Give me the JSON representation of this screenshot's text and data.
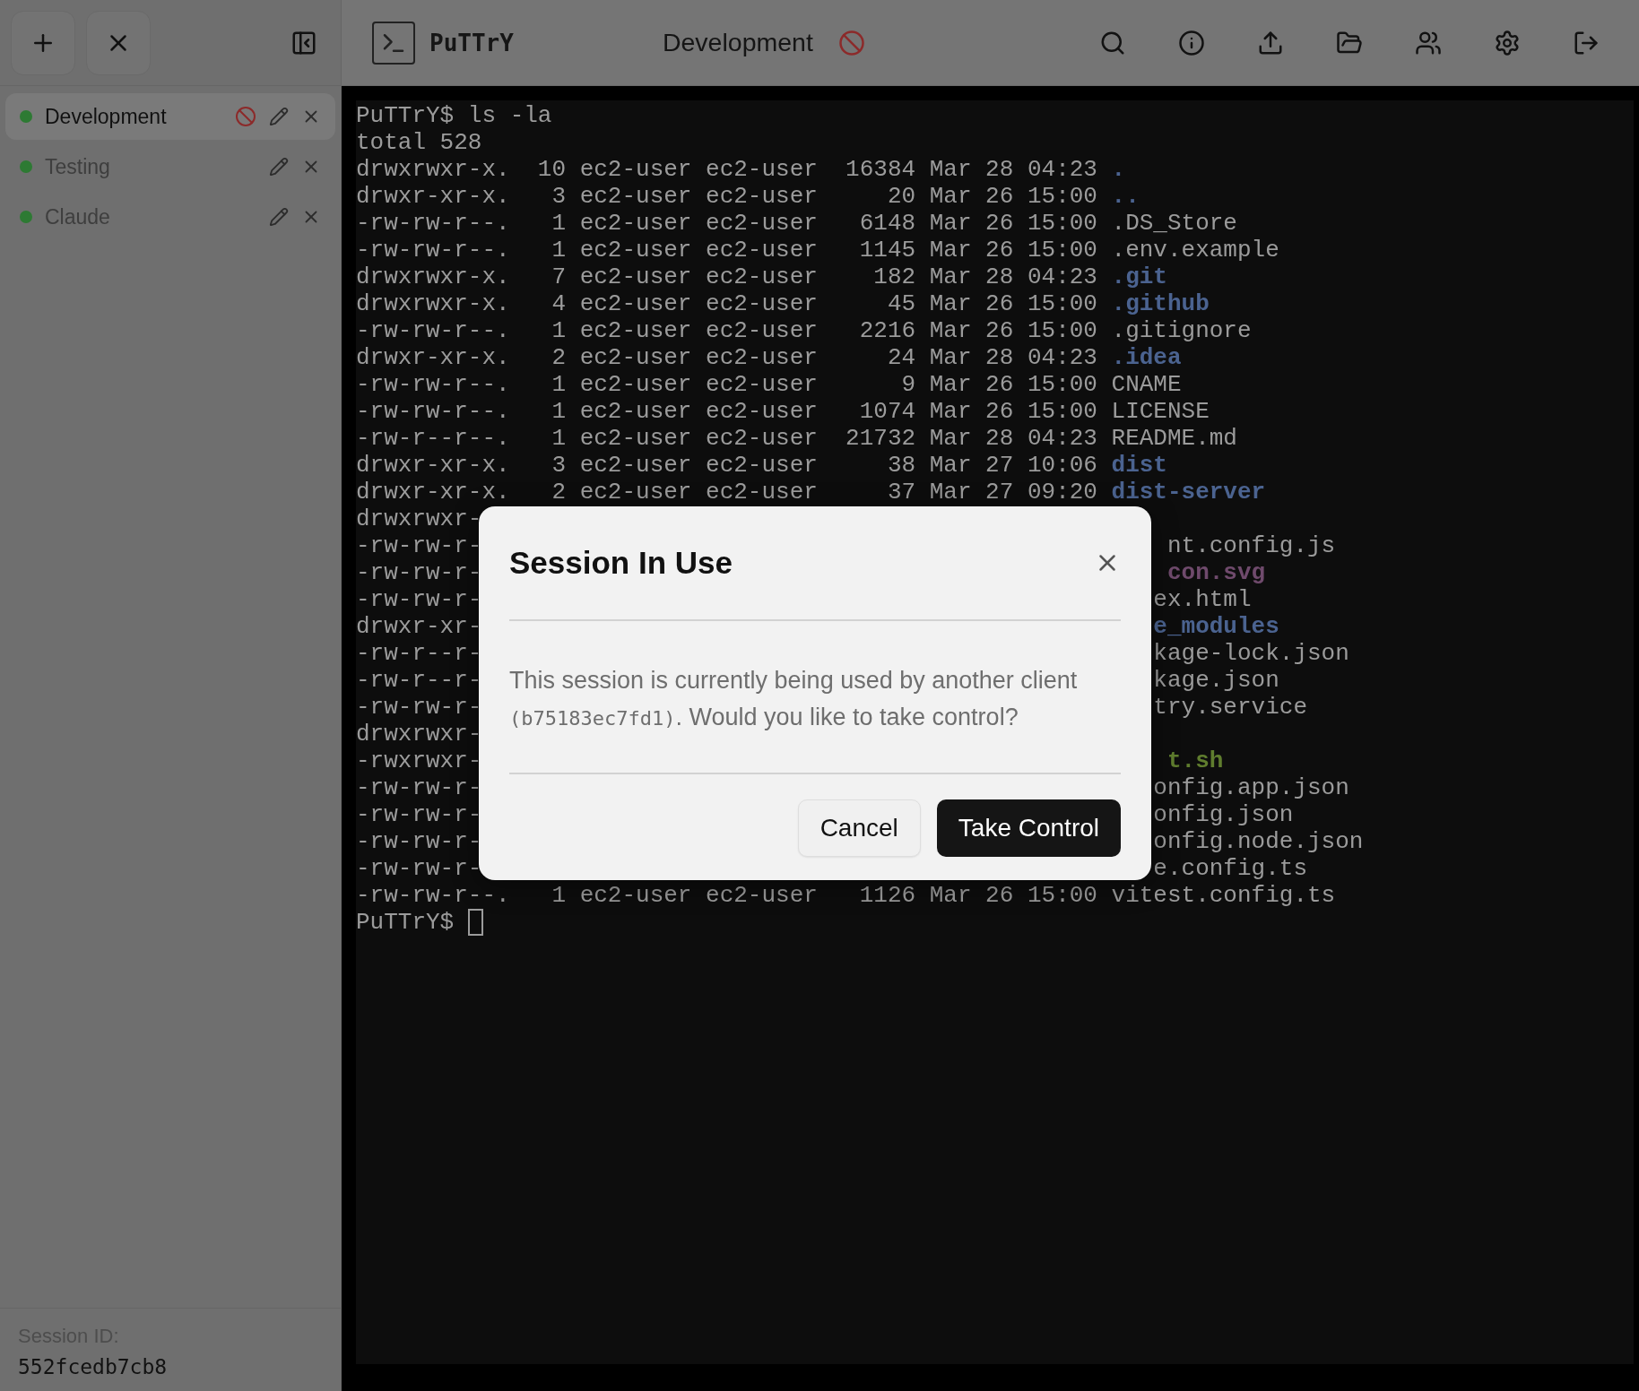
{
  "sidebar": {
    "sessions": [
      {
        "name": "Development",
        "selected": true,
        "in_use": true
      },
      {
        "name": "Testing",
        "selected": false,
        "in_use": false
      },
      {
        "name": "Claude",
        "selected": false,
        "in_use": false
      }
    ],
    "footer": {
      "label": "Session ID:",
      "value": "552fcedb7cb8"
    }
  },
  "header": {
    "app_name": "PuTTrY",
    "session_title": "Development",
    "in_use": true
  },
  "terminal": {
    "lines": [
      {
        "kind": "text",
        "text": "PuTTrY$ ls -la"
      },
      {
        "kind": "text",
        "text": "total 528"
      },
      {
        "kind": "entry",
        "info": "drwxrwxr-x.  10 ec2-user ec2-user  16384 Mar 28 04:23",
        "name": ".",
        "color": "#4b6390",
        "bold": true
      },
      {
        "kind": "entry",
        "info": "drwxr-xr-x.   3 ec2-user ec2-user     20 Mar 26 15:00",
        "name": "..",
        "color": "#4b6390",
        "bold": true
      },
      {
        "kind": "entry",
        "info": "-rw-rw-r--.   1 ec2-user ec2-user   6148 Mar 26 15:00",
        "name": ".DS_Store",
        "color": "#9b9b9b",
        "bold": false
      },
      {
        "kind": "entry",
        "info": "-rw-rw-r--.   1 ec2-user ec2-user   1145 Mar 26 15:00",
        "name": ".env.example",
        "color": "#9b9b9b",
        "bold": false
      },
      {
        "kind": "entry",
        "info": "drwxrwxr-x.   7 ec2-user ec2-user    182 Mar 28 04:23",
        "name": ".git",
        "color": "#4b6390",
        "bold": true
      },
      {
        "kind": "entry",
        "info": "drwxrwxr-x.   4 ec2-user ec2-user     45 Mar 26 15:00",
        "name": ".github",
        "color": "#4b6390",
        "bold": true
      },
      {
        "kind": "entry",
        "info": "-rw-rw-r--.   1 ec2-user ec2-user   2216 Mar 26 15:00",
        "name": ".gitignore",
        "color": "#9b9b9b",
        "bold": false
      },
      {
        "kind": "entry",
        "info": "drwxr-xr-x.   2 ec2-user ec2-user     24 Mar 28 04:23",
        "name": ".idea",
        "color": "#4b6390",
        "bold": true
      },
      {
        "kind": "entry",
        "info": "-rw-rw-r--.   1 ec2-user ec2-user      9 Mar 26 15:00",
        "name": "CNAME",
        "color": "#9b9b9b",
        "bold": false
      },
      {
        "kind": "entry",
        "info": "-rw-rw-r--.   1 ec2-user ec2-user   1074 Mar 26 15:00",
        "name": "LICENSE",
        "color": "#9b9b9b",
        "bold": false
      },
      {
        "kind": "entry",
        "info": "-rw-r--r--.   1 ec2-user ec2-user  21732 Mar 28 04:23",
        "name": "README.md",
        "color": "#9b9b9b",
        "bold": false
      },
      {
        "kind": "entry",
        "info": "drwxr-xr-x.   3 ec2-user ec2-user     38 Mar 27 10:06",
        "name": "dist",
        "color": "#4b6390",
        "bold": true
      },
      {
        "kind": "entry",
        "info": "drwxr-xr-x.   2 ec2-user ec2-user     37 Mar 27 09:20",
        "name": "dist-server",
        "color": "#4b6390",
        "bold": true
      },
      {
        "kind": "covered",
        "start": "drwxrwxr-"
      },
      {
        "kind": "covered",
        "start": "-rw-rw-r-",
        "end": "nt.config.js",
        "color": "#9b9b9b",
        "bold": false
      },
      {
        "kind": "covered",
        "start": "-rw-rw-r-",
        "end": "con.svg",
        "color": "#6f4a6c",
        "bold": true
      },
      {
        "kind": "covered",
        "start": "-rw-rw-r-",
        "end": "ex.html",
        "color": "#9b9b9b",
        "bold": false
      },
      {
        "kind": "covered",
        "start": "drwxr-xr-",
        "end": "e_modules",
        "color": "#4b6390",
        "bold": true
      },
      {
        "kind": "covered",
        "start": "-rw-r--r-",
        "end": "kage-lock.json",
        "color": "#9b9b9b",
        "bold": false
      },
      {
        "kind": "covered",
        "start": "-rw-r--r-",
        "end": "kage.json",
        "color": "#9b9b9b",
        "bold": false
      },
      {
        "kind": "covered",
        "start": "-rw-rw-r-",
        "end": "try.service",
        "color": "#9b9b9b",
        "bold": false
      },
      {
        "kind": "covered",
        "start": "drwxrwxr-"
      },
      {
        "kind": "covered",
        "start": "-rwxrwxr-",
        "end": "t.sh",
        "color": "#5f7d2e",
        "bold": true
      },
      {
        "kind": "covered",
        "start": "-rw-rw-r-",
        "end": "onfig.app.json",
        "color": "#9b9b9b",
        "bold": false
      },
      {
        "kind": "covered",
        "start": "-rw-rw-r-",
        "end": "onfig.json",
        "color": "#9b9b9b",
        "bold": false
      },
      {
        "kind": "covered",
        "start": "-rw-rw-r-",
        "end": "onfig.node.json",
        "color": "#9b9b9b",
        "bold": false
      },
      {
        "kind": "covered",
        "start": "-rw-rw-r-",
        "end": "e.config.ts",
        "color": "#9b9b9b",
        "bold": false
      },
      {
        "kind": "entry",
        "info": "-rw-rw-r--.   1 ec2-user ec2-user   1126 Mar 26 15:00",
        "name": "vitest.config.ts",
        "color": "#9b9b9b",
        "bold": false
      },
      {
        "kind": "prompt",
        "text": "PuTTrY$"
      }
    ]
  },
  "dialog": {
    "title": "Session In Use",
    "message_before": "This session is currently being used by another client",
    "client_id": "(b75183ec7fd1)",
    "message_after": ". Would you like to take control?",
    "buttons": [
      {
        "label": "Cancel",
        "kind": "secondary"
      },
      {
        "label": "Take Control",
        "kind": "primary"
      }
    ]
  }
}
